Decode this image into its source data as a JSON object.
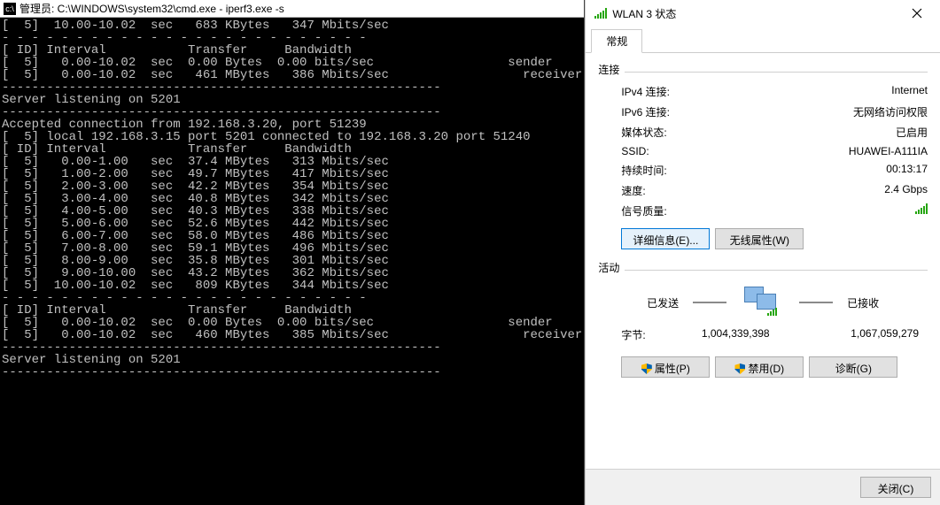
{
  "terminal": {
    "title": "管理员: C:\\WINDOWS\\system32\\cmd.exe - iperf3.exe  -s",
    "lines": [
      "[  5]  10.00-10.02  sec   683 KBytes   347 Mbits/sec",
      "- - - - - - - - - - - - - - - - - - - - - - - - -",
      "[ ID] Interval           Transfer     Bandwidth",
      "[  5]   0.00-10.02  sec  0.00 Bytes  0.00 bits/sec                  sender",
      "[  5]   0.00-10.02  sec   461 MBytes   386 Mbits/sec                  receiver",
      "-----------------------------------------------------------",
      "Server listening on 5201",
      "-----------------------------------------------------------",
      "Accepted connection from 192.168.3.20, port 51239",
      "[  5] local 192.168.3.15 port 5201 connected to 192.168.3.20 port 51240",
      "[ ID] Interval           Transfer     Bandwidth",
      "[  5]   0.00-1.00   sec  37.4 MBytes   313 Mbits/sec",
      "[  5]   1.00-2.00   sec  49.7 MBytes   417 Mbits/sec",
      "[  5]   2.00-3.00   sec  42.2 MBytes   354 Mbits/sec",
      "[  5]   3.00-4.00   sec  40.8 MBytes   342 Mbits/sec",
      "[  5]   4.00-5.00   sec  40.3 MBytes   338 Mbits/sec",
      "[  5]   5.00-6.00   sec  52.6 MBytes   442 Mbits/sec",
      "[  5]   6.00-7.00   sec  58.0 MBytes   486 Mbits/sec",
      "[  5]   7.00-8.00   sec  59.1 MBytes   496 Mbits/sec",
      "[  5]   8.00-9.00   sec  35.8 MBytes   301 Mbits/sec",
      "[  5]   9.00-10.00  sec  43.2 MBytes   362 Mbits/sec",
      "[  5]  10.00-10.02  sec   809 KBytes   344 Mbits/sec",
      "- - - - - - - - - - - - - - - - - - - - - - - - -",
      "[ ID] Interval           Transfer     Bandwidth",
      "[  5]   0.00-10.02  sec  0.00 Bytes  0.00 bits/sec                  sender",
      "[  5]   0.00-10.02  sec   460 MBytes   385 Mbits/sec                  receiver",
      "-----------------------------------------------------------",
      "Server listening on 5201",
      "-----------------------------------------------------------"
    ]
  },
  "dialog": {
    "title": "WLAN 3 状态",
    "tab": "常规",
    "conn_group": "连接",
    "conn_rows": [
      {
        "k": "IPv4 连接:",
        "v": "Internet"
      },
      {
        "k": "IPv6 连接:",
        "v": "无网络访问权限"
      },
      {
        "k": "媒体状态:",
        "v": "已启用"
      },
      {
        "k": "SSID:",
        "v": "HUAWEI-A111IA"
      },
      {
        "k": "持续时间:",
        "v": "00:13:17"
      },
      {
        "k": "速度:",
        "v": "2.4 Gbps"
      }
    ],
    "signal_label": "信号质量:",
    "activity_group": "活动",
    "sent_label": "已发送",
    "recv_label": "已接收",
    "bytes_label": "字节:",
    "bytes_sent": "1,004,339,398",
    "bytes_recv": "1,067,059,279",
    "buttons": {
      "details": "详细信息(E)...",
      "wireless_props": "无线属性(W)",
      "properties": "属性(P)",
      "disable": "禁用(D)",
      "diagnose": "诊断(G)",
      "close": "关闭(C)"
    }
  }
}
